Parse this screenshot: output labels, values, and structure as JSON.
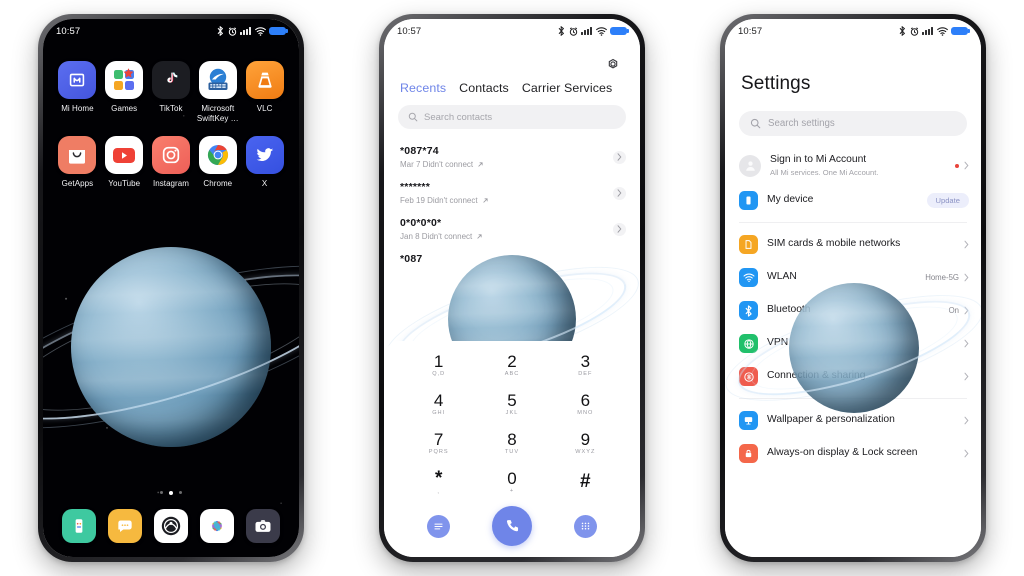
{
  "meta": {
    "status_time": "10:57",
    "accent_blue": "#6f85e8",
    "wallpaper_planet": "ringed-blue-planet"
  },
  "home_screen": {
    "name": "MIUI Home Screen",
    "status_time": "10:57",
    "apps": [
      {
        "label": "Mi Home",
        "icon": "mi-home-icon"
      },
      {
        "label": "Games",
        "icon": "games-icon"
      },
      {
        "label": "TikTok",
        "icon": "tiktok-icon"
      },
      {
        "label": "Microsoft SwiftKey …",
        "icon": "microsoft-swiftkey-icon"
      },
      {
        "label": "VLC",
        "icon": "vlc-icon"
      },
      {
        "label": "GetApps",
        "icon": "getapps-icon"
      },
      {
        "label": "YouTube",
        "icon": "youtube-icon"
      },
      {
        "label": "Instagram",
        "icon": "instagram-icon"
      },
      {
        "label": "Chrome",
        "icon": "chrome-icon"
      },
      {
        "label": "X",
        "icon": "twitter-x-icon"
      }
    ],
    "page_dots": {
      "count": 3,
      "active_index": 1
    },
    "dock": [
      {
        "label": "Phone",
        "icon": "phone-icon"
      },
      {
        "label": "Messages",
        "icon": "messages-icon"
      },
      {
        "label": "Browser",
        "icon": "browser-icon"
      },
      {
        "label": "Gallery",
        "icon": "gallery-icon"
      },
      {
        "label": "Camera",
        "icon": "camera-icon"
      }
    ]
  },
  "dialer_screen": {
    "name": "Phone / Dialer",
    "status_time": "10:57",
    "settings_icon": "gear-icon",
    "tabs": [
      {
        "label": "Recents",
        "active": true
      },
      {
        "label": "Contacts",
        "active": false
      },
      {
        "label": "Carrier Services",
        "active": false
      }
    ],
    "search": {
      "placeholder": "Search contacts",
      "value": "",
      "icon": "search-icon"
    },
    "calls": [
      {
        "number": "*087*74",
        "meta": "Mar 7 Didn't connect",
        "direction": "outgoing"
      },
      {
        "number": "*******",
        "meta": "Feb 19 Didn't connect",
        "direction": "outgoing"
      },
      {
        "number": "0*0*0*0*",
        "meta": "Jan 8 Didn't connect",
        "direction": "outgoing"
      },
      {
        "number": "*087",
        "meta": "",
        "direction": "outgoing"
      }
    ],
    "keypad": [
      {
        "digit": "1",
        "sub": "Q,D"
      },
      {
        "digit": "2",
        "sub": "ABC"
      },
      {
        "digit": "3",
        "sub": "DEF"
      },
      {
        "digit": "4",
        "sub": "GHI"
      },
      {
        "digit": "5",
        "sub": "JKL"
      },
      {
        "digit": "6",
        "sub": "MNO"
      },
      {
        "digit": "7",
        "sub": "PQRS"
      },
      {
        "digit": "8",
        "sub": "TUV"
      },
      {
        "digit": "9",
        "sub": "WXYZ"
      },
      {
        "digit": "*",
        "sub": ","
      },
      {
        "digit": "0",
        "sub": "+"
      },
      {
        "digit": "#",
        "sub": ""
      }
    ],
    "actions": {
      "menu": "menu-icon",
      "call": "call-icon",
      "keypad_toggle": "dialpad-icon"
    }
  },
  "settings_screen": {
    "name": "Settings",
    "status_time": "10:57",
    "title": "Settings",
    "search": {
      "placeholder": "Search settings",
      "value": "",
      "icon": "search-icon"
    },
    "account": {
      "label": "Sign in to Mi Account",
      "sub": "All Mi services. One Mi Account.",
      "icon": "account-avatar-icon",
      "badge_dot": true
    },
    "device": {
      "label": "My device",
      "icon": "my-device-icon",
      "pill": "Update",
      "icon_color": "#2196f3"
    },
    "groups": [
      {
        "items": [
          {
            "label": "SIM cards & mobile networks",
            "value": "",
            "icon": "sim-card-icon",
            "icon_color": "#f5a623"
          },
          {
            "label": "WLAN",
            "value": "Home-5G",
            "icon": "wifi-icon",
            "icon_color": "#2196f3"
          },
          {
            "label": "Bluetooth",
            "value": "On",
            "icon": "bluetooth-icon",
            "icon_color": "#2196f3"
          },
          {
            "label": "VPN",
            "value": "",
            "icon": "vpn-globe-icon",
            "icon_color": "#21c06b"
          },
          {
            "label": "Connection & sharing",
            "value": "",
            "icon": "connection-sharing-icon",
            "icon_color": "#ef5c4e"
          }
        ]
      },
      {
        "items": [
          {
            "label": "Wallpaper & personalization",
            "value": "",
            "icon": "wallpaper-icon",
            "icon_color": "#2196f3"
          },
          {
            "label": "Always-on display & Lock screen",
            "value": "",
            "icon": "lock-screen-icon",
            "icon_color": "#f4674a"
          }
        ]
      }
    ]
  }
}
